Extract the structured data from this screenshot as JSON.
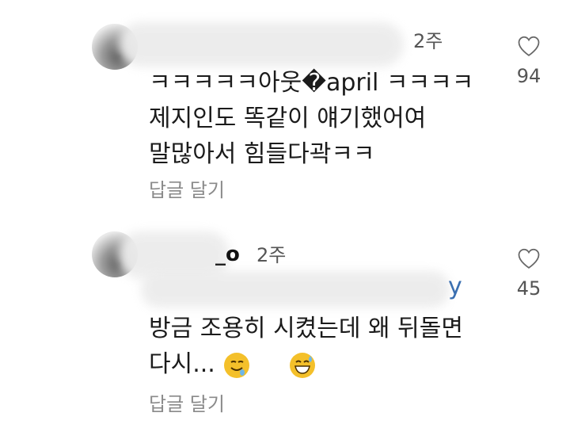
{
  "comments": [
    {
      "username_visible": "",
      "time": "2주",
      "lines": [
        "ㅋㅋㅋㅋㅋ아웃�april ㅋㅋㅋㅋ",
        "제지인도 똑같이 얘기했어여",
        "말많아서 힘들다곽ㅋㅋ"
      ],
      "reply_label": "답글 달기",
      "likes": "94"
    },
    {
      "username_visible": "_o",
      "time": "2주",
      "mention_visible": "y",
      "lines": [
        "방금 조용히 시켰는데 왜 뒤돌면",
        "다시..."
      ],
      "reply_label": "답글 달기",
      "likes": "45"
    }
  ],
  "icons": {
    "like": "heart-outline-icon",
    "emoji_1": "drooling-smile-emoji",
    "emoji_2": "grinning-sweat-emoji"
  },
  "colors": {
    "text": "#1b1b1b",
    "muted": "#8a8a8a",
    "mention": "#3a6fb0"
  }
}
